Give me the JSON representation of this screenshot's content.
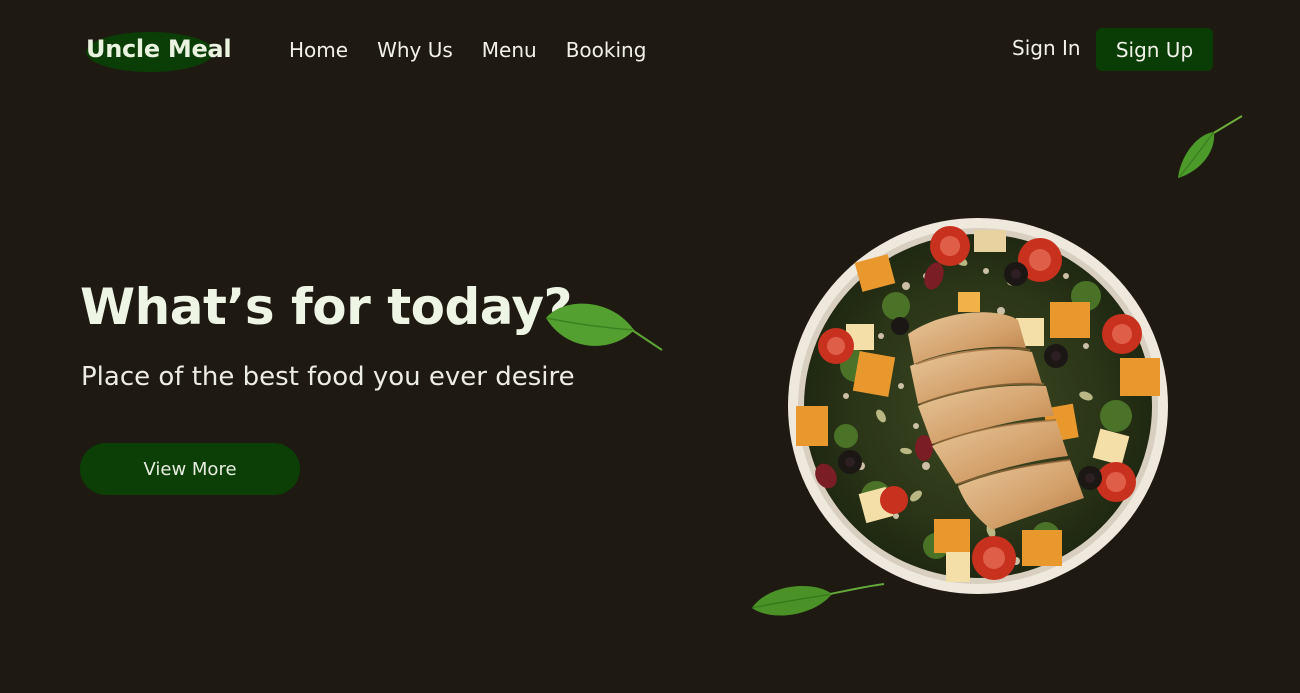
{
  "brand": {
    "name": "Uncle Meal"
  },
  "nav": {
    "items": [
      {
        "label": "Home"
      },
      {
        "label": "Why Us"
      },
      {
        "label": "Menu"
      },
      {
        "label": "Booking"
      }
    ]
  },
  "auth": {
    "sign_in": "Sign In",
    "sign_up": "Sign Up"
  },
  "hero": {
    "title": "What’s for today?",
    "subtitle": "Place of the best food you ever desire",
    "cta": "View More"
  },
  "colors": {
    "background": "#1e1a12",
    "accent_green": "#0a3d06",
    "leaf_green": "#4f9a2a",
    "text": "#f1f1ea"
  },
  "icons": [
    "leaf-icon",
    "salad-bowl-image"
  ]
}
